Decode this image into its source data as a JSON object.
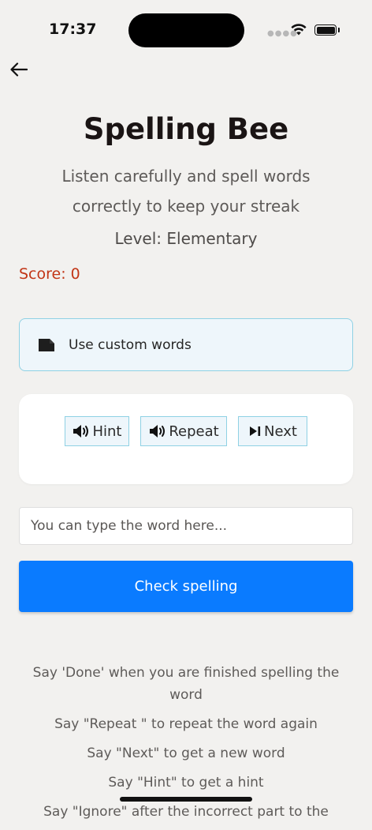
{
  "status": {
    "time": "17:37"
  },
  "header": {
    "title": "Spelling Bee",
    "subtitle": "Listen carefully and spell words correctly to keep your streak",
    "level": "Level: Elementary",
    "score": "Score: 0"
  },
  "custom_words": {
    "label": "Use custom words",
    "icon": "document-icon"
  },
  "controls": {
    "hint": "Hint",
    "repeat": "Repeat",
    "next": "Next"
  },
  "input": {
    "placeholder": "You can type the word here...",
    "value": ""
  },
  "check_button": "Check spelling",
  "instructions": [
    "Say 'Done' when you are finished spelling the word",
    "Say \"Repeat \" to repeat the word again",
    "Say \"Next\" to get a new word",
    "Say \"Hint\" to get a hint",
    "Say \"Ignore\" after the incorrect part to the"
  ],
  "colors": {
    "accent_blue": "#0a7bff",
    "score_red": "#c23617",
    "light_panel": "#eef6fb",
    "panel_border": "#8fd1e4",
    "background": "#f2f1ef"
  }
}
